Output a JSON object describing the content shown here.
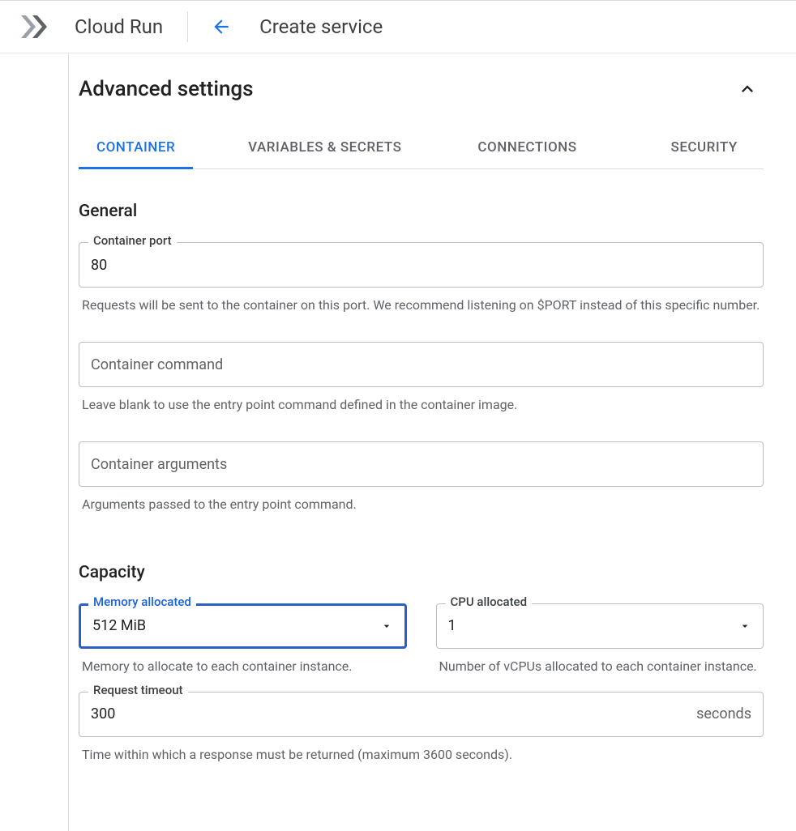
{
  "header": {
    "product": "Cloud Run",
    "page_title": "Create service"
  },
  "section": {
    "title": "Advanced settings"
  },
  "tabs": [
    {
      "label": "CONTAINER",
      "active": true
    },
    {
      "label": "VARIABLES & SECRETS",
      "active": false
    },
    {
      "label": "CONNECTIONS",
      "active": false
    },
    {
      "label": "SECURITY",
      "active": false
    }
  ],
  "general": {
    "heading": "General",
    "port": {
      "label": "Container port",
      "value": "80",
      "helper": "Requests will be sent to the container on this port. We recommend listening on $PORT instead of this specific number."
    },
    "command": {
      "placeholder": "Container command",
      "value": "",
      "helper": "Leave blank to use the entry point command defined in the container image."
    },
    "arguments": {
      "placeholder": "Container arguments",
      "value": "",
      "helper": "Arguments passed to the entry point command."
    }
  },
  "capacity": {
    "heading": "Capacity",
    "memory": {
      "label": "Memory allocated",
      "value": "512 MiB",
      "helper": "Memory to allocate to each container instance."
    },
    "cpu": {
      "label": "CPU allocated",
      "value": "1",
      "helper": "Number of vCPUs allocated to each container instance."
    },
    "timeout": {
      "label": "Request timeout",
      "value": "300",
      "suffix": "seconds",
      "helper": "Time within which a response must be returned (maximum 3600 seconds)."
    }
  }
}
